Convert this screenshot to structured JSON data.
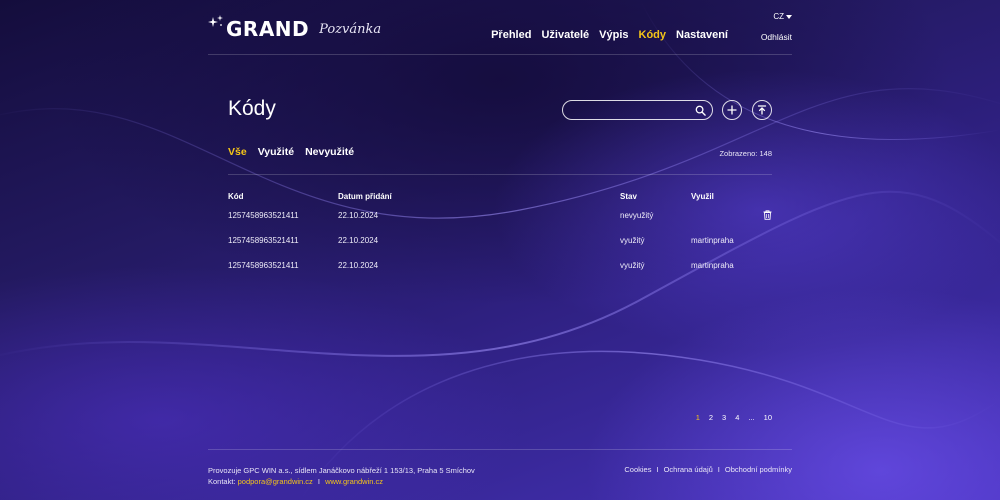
{
  "brand": {
    "name": "GRAND",
    "subtitle": "Pozvánka"
  },
  "lang": {
    "current": "CZ"
  },
  "nav": {
    "items": [
      {
        "label": "Přehled",
        "active": false
      },
      {
        "label": "Uživatelé",
        "active": false
      },
      {
        "label": "Výpis",
        "active": false
      },
      {
        "label": "Kódy",
        "active": true
      },
      {
        "label": "Nastavení",
        "active": false
      }
    ],
    "logout": "Odhlásit"
  },
  "page": {
    "title": "Kódy",
    "search_placeholder": "",
    "filters": [
      {
        "label": "Vše",
        "active": true
      },
      {
        "label": "Využité",
        "active": false
      },
      {
        "label": "Nevyužité",
        "active": false
      }
    ],
    "shown_label": "Zobrazeno: 148"
  },
  "table": {
    "headers": {
      "code": "Kód",
      "date": "Datum přidání",
      "status": "Stav",
      "used_by": "Využil"
    },
    "rows": [
      {
        "code": "1257458963521411",
        "date": "22.10.2024",
        "status": "nevyužitý",
        "used_by": "",
        "deletable": true
      },
      {
        "code": "1257458963521411",
        "date": "22.10.2024",
        "status": "využitý",
        "used_by": "martinpraha",
        "deletable": false
      },
      {
        "code": "1257458963521411",
        "date": "22.10.2024",
        "status": "využitý",
        "used_by": "martinpraha",
        "deletable": false
      }
    ]
  },
  "pagination": {
    "pages": [
      "1",
      "2",
      "3",
      "4",
      "...",
      "10"
    ],
    "current": "1"
  },
  "footer": {
    "operator": "Provozuje GPC WIN a.s., sídlem Janáčkovo nábřeží 1 153/13, Praha 5 Smíchov",
    "contact_label": "Kontakt:",
    "email": "podpora@grandwin.cz",
    "separator": "I",
    "website": "www.grandwin.cz",
    "links": [
      "Cookies",
      "Ochrana údajů",
      "Obchodní podmínky"
    ]
  },
  "colors": {
    "accent": "#f5c518",
    "background": "#2a1d74"
  },
  "icons": [
    "stars-icon",
    "caret-down-icon",
    "search-icon",
    "plus-icon",
    "upload-icon",
    "trash-icon"
  ]
}
